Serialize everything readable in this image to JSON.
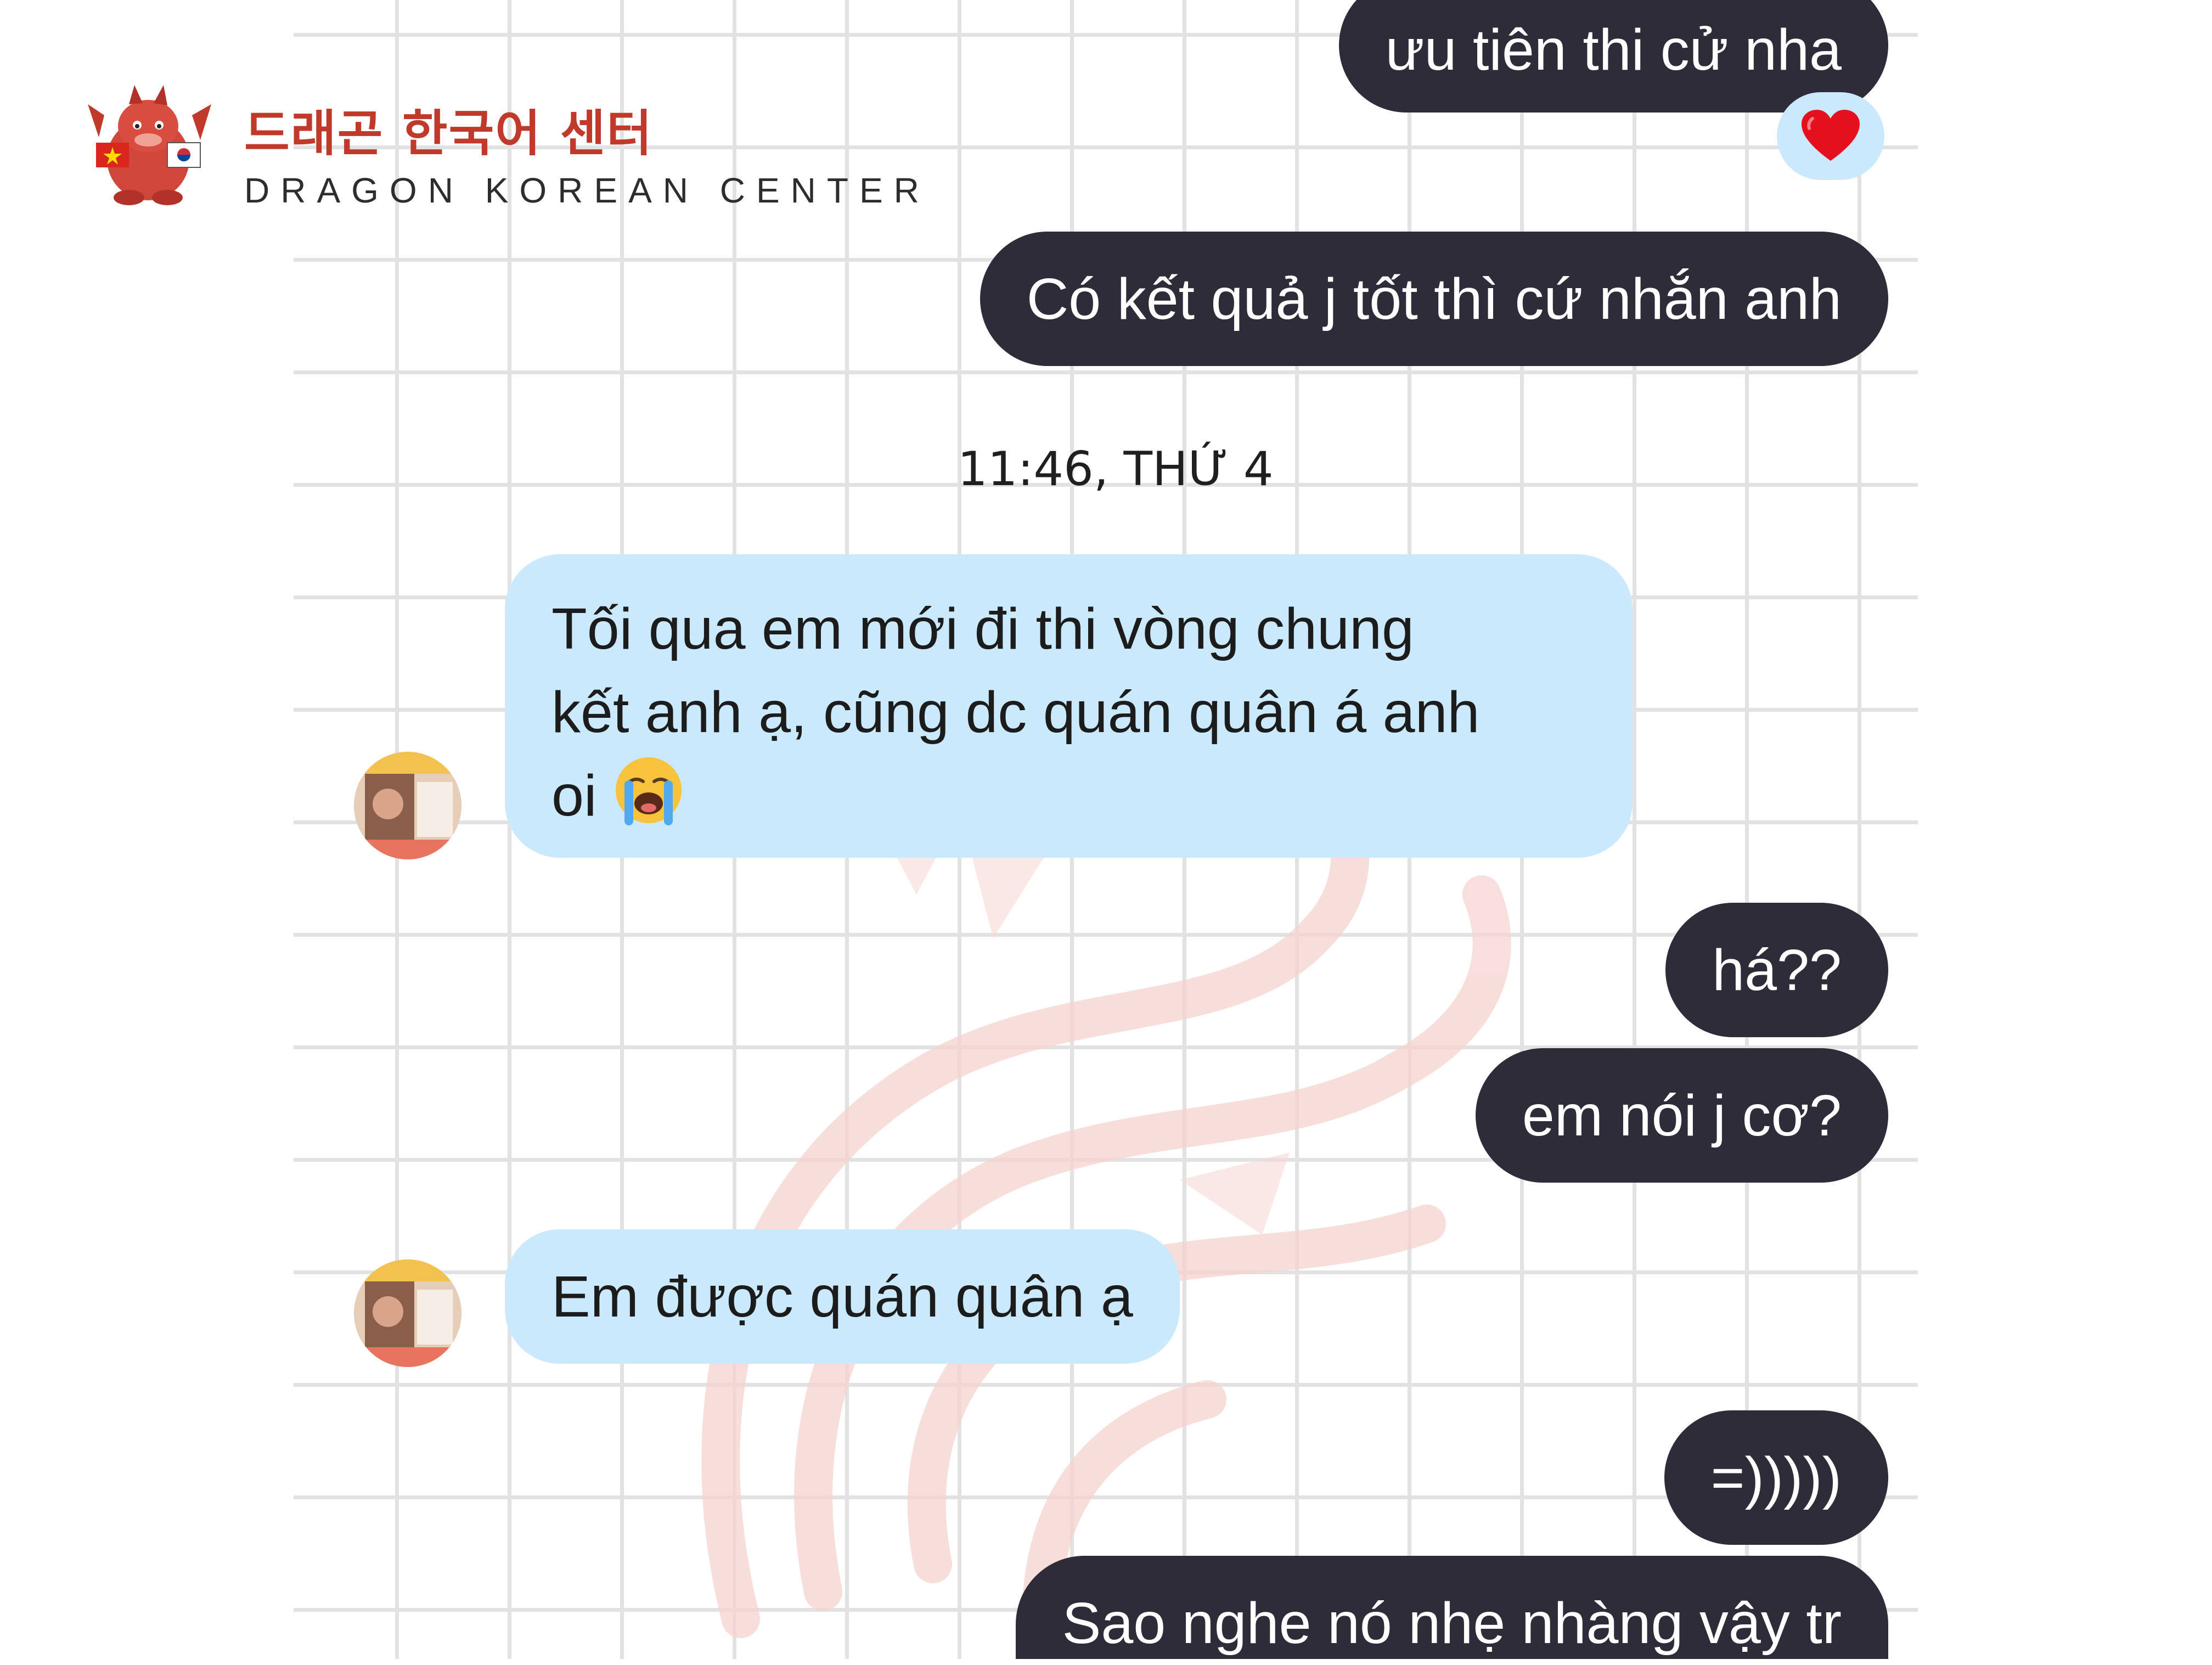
{
  "brand": {
    "korean_name": "드래곤 한국어 센터",
    "english_name": "DRAGON KOREAN CENTER"
  },
  "chat": {
    "messages": [
      {
        "id": "m1",
        "direction": "outgoing",
        "text": "ưu tiên thi cử nha",
        "reaction": "heart"
      },
      {
        "id": "m2",
        "direction": "outgoing",
        "text": "Có kết quả j tốt thì cứ nhắn anh"
      },
      {
        "id": "m3",
        "direction": "incoming",
        "lines": [
          "Tối qua em mới đi thi vòng chung",
          "kết anh ạ, cũng dc quán quân á anh",
          "oi"
        ],
        "emoji": "crying-face"
      },
      {
        "id": "m4",
        "direction": "outgoing",
        "text": "há??"
      },
      {
        "id": "m5",
        "direction": "outgoing",
        "text": "em nói j cơ?"
      },
      {
        "id": "m6",
        "direction": "incoming",
        "text": "Em được quán quân ạ"
      },
      {
        "id": "m7",
        "direction": "outgoing",
        "text": "=)))))"
      },
      {
        "id": "m8",
        "direction": "outgoing",
        "text": "Sao nghe nó nhẹ nhàng vậy tr"
      }
    ],
    "timestamp": "11:46, THỨ 4"
  },
  "colors": {
    "outgoing_bubble": "#2e2c38",
    "incoming_bubble": "#cbe9fc",
    "brand_red": "#c0392b",
    "grid_line": "#e2e2e2"
  },
  "icons": {
    "reaction": "heart-icon",
    "emoji": "crying-face-icon",
    "logo": "dragon-logo",
    "avatar": "contact-avatar"
  }
}
